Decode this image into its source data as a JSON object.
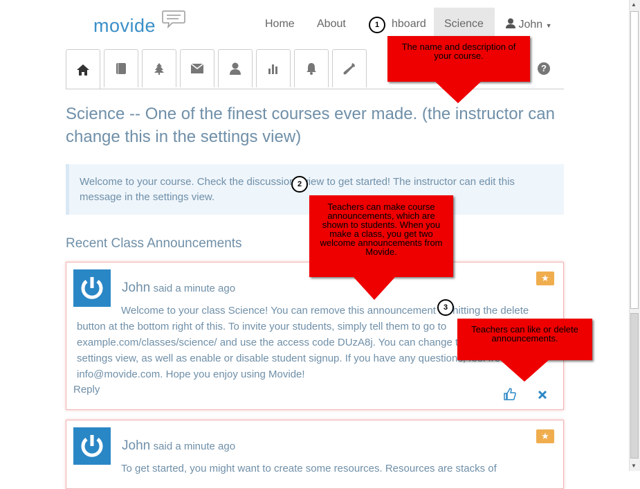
{
  "navbar": {
    "logo": "movide",
    "items": [
      "Home",
      "About",
      "Dashboard",
      "Science"
    ],
    "dashboard_visible": "hboard",
    "user": "John"
  },
  "tabs": [
    {
      "icon": "home-icon"
    },
    {
      "icon": "book-icon"
    },
    {
      "icon": "tree-icon"
    },
    {
      "icon": "envelope-icon"
    },
    {
      "icon": "user-icon"
    },
    {
      "icon": "bar-chart-icon"
    },
    {
      "icon": "bell-icon"
    },
    {
      "icon": "wrench-icon"
    }
  ],
  "help_icon": "?",
  "course_title": "Science -- One of the finest courses ever made. (the instructor can change this in the settings view)",
  "welcome_message": "Welcome to your course. Check the discussions view to get started! The instructor can edit this message in the settings view.",
  "recent_heading": "Recent Class Announcements",
  "announcements": [
    {
      "author": "John",
      "said": "said a minute ago",
      "body": "Welcome to your class Science! You can remove this announcement by hitting the delete button at the bottom right of this. To invite your students, simply tell them to go to example.com/classes/science/ and use the access code DUzA8j. You can change the code in the settings view, as well as enable or disable student signup. If you have any questions, feel free to email info@movide.com. Hope you enjoy using Movide!",
      "reply": "Reply"
    },
    {
      "author": "John",
      "said": "said a minute ago",
      "body": "To get started, you might want to create some resources. Resources are stacks of",
      "reply": "Reply"
    }
  ],
  "callouts": [
    {
      "number": "1",
      "text": "The name and description of your course."
    },
    {
      "number": "2",
      "text": "Teachers can make course announcements, which are shown to students. When you make a class, you get two welcome announcements from Movide."
    },
    {
      "number": "3",
      "text": "Teachers can like or delete announcements."
    }
  ],
  "colors": {
    "accent": "#2a87c6",
    "callout": "#ee0000",
    "badge": "#f0ad4e"
  }
}
